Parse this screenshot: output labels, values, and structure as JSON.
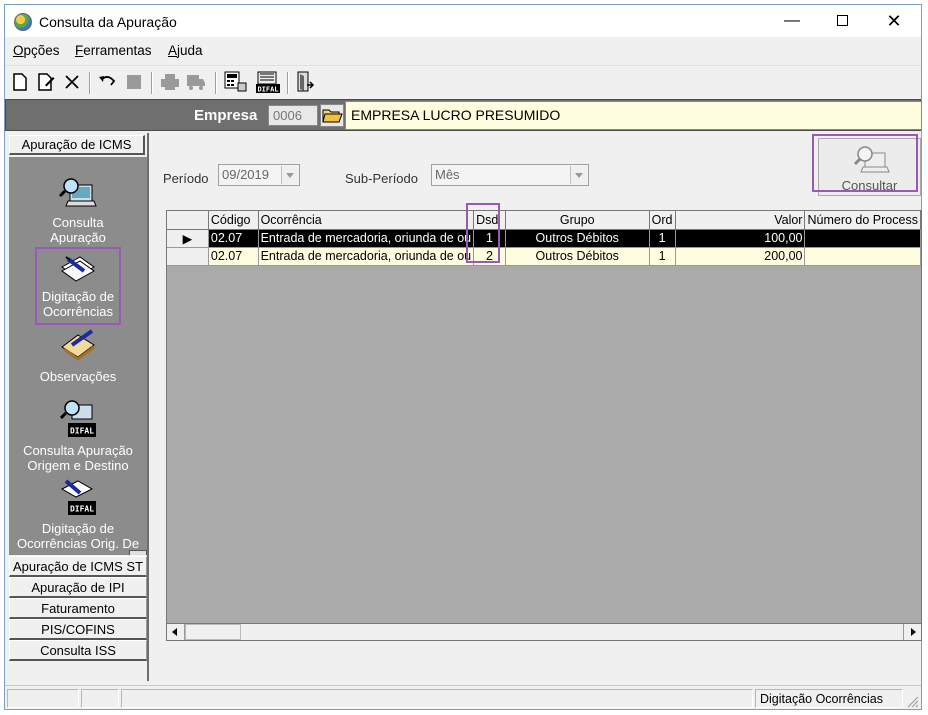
{
  "window": {
    "title": "Consulta da Apuração"
  },
  "menu": [
    {
      "label": "Opções",
      "accel": "O",
      "rest": "pções"
    },
    {
      "label": "Ferramentas",
      "accel": "F",
      "rest": "erramentas"
    },
    {
      "label": "Ajuda",
      "accel": "A",
      "rest": "juda"
    }
  ],
  "toolbar": {
    "icons": [
      "new-doc-icon",
      "edit-doc-icon",
      "delete-icon",
      "undo-icon",
      "stop-icon",
      "print-icon",
      "truck-icon",
      "calculator-icon",
      "difal-icon",
      "exit-icon"
    ]
  },
  "empresa": {
    "label": "Empresa",
    "code": "0006",
    "name": "EMPRESA LUCRO PRESUMIDO"
  },
  "sidebar": {
    "section": "Apuração de ICMS",
    "entries": [
      {
        "line1": "Consulta",
        "line2": "Apuração"
      },
      {
        "line1": "Digitação de",
        "line2": "Ocorrências"
      },
      {
        "line1": "Observações",
        "line2": ""
      },
      {
        "line1": "Consulta Apuração",
        "line2": "Origem e Destino"
      },
      {
        "line1": "Digitação de",
        "line2": "Ocorrências Orig. De"
      }
    ],
    "difal_badge": "DIFAL",
    "tabs": [
      "Apuração de ICMS ST",
      "Apuração de IPI",
      "Faturamento",
      "PIS/COFINS",
      "Consulta ISS"
    ]
  },
  "filters": {
    "periodo_label": "Período",
    "periodo_value": "09/2019",
    "subperiodo_label": "Sub-Período",
    "subperiodo_value": "Mês"
  },
  "consultar": {
    "label": "Consultar"
  },
  "grid": {
    "columns": [
      "Código",
      "Ocorrência",
      "Dsd",
      "Grupo",
      "Ord",
      "Valor",
      "Número do Process"
    ],
    "rows": [
      {
        "codigo": "02.07",
        "ocorrencia": "Entrada de mercadoria, oriunda de ou",
        "dsd": "1",
        "grupo": "Outros Débitos",
        "ord": "1",
        "valor": "100,00",
        "processo": ""
      },
      {
        "codigo": "02.07",
        "ocorrencia": "Entrada de mercadoria, oriunda de ou",
        "dsd": "2",
        "grupo": "Outros Débitos",
        "ord": "1",
        "valor": "200,00",
        "processo": ""
      }
    ]
  },
  "status": {
    "text": "Digitação Ocorrências"
  },
  "colors": {
    "highlight": "#9b59b6",
    "grid_row": "#fffde0",
    "selected_row": "#000000",
    "sidebar_panel": "#8c8c8c",
    "empresa_bar": "#6f6f6f"
  }
}
